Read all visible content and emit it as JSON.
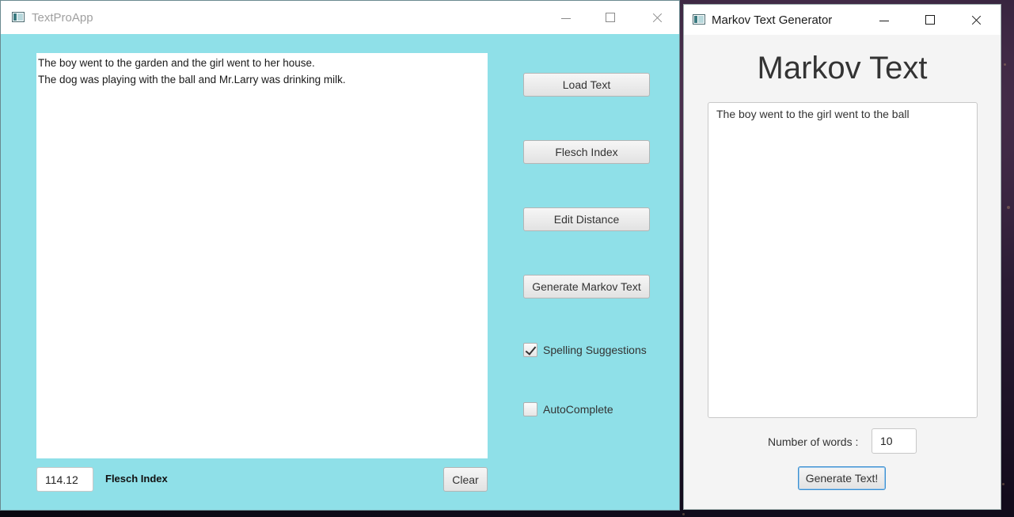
{
  "textpro": {
    "title": "TextProApp",
    "text_lines": [
      "The boy went to the garden and the girl went to her house.",
      "The dog was playing with the ball and Mr.Larry was drinking milk."
    ],
    "buttons": {
      "load": "Load Text",
      "flesch": "Flesch Index",
      "edit_distance": "Edit Distance",
      "markov": "Generate Markov Text",
      "clear": "Clear"
    },
    "checkboxes": {
      "spelling": {
        "label": "Spelling Suggestions",
        "checked": true
      },
      "autocomplete": {
        "label": "AutoComplete",
        "checked": false
      }
    },
    "flesch_value": "114.12",
    "flesch_label": "Flesch Index"
  },
  "markov": {
    "title": "Markov Text Generator",
    "heading": "Markov Text",
    "generated_text": "The boy went to the girl went to the ball",
    "num_words_label": "Number of words :",
    "num_words_value": "10",
    "generate_label": "Generate Text!"
  },
  "colors": {
    "textpro_background": "#8fe0e8",
    "markov_background": "#f4f4f4",
    "focus_accent": "#3a8fd0"
  }
}
